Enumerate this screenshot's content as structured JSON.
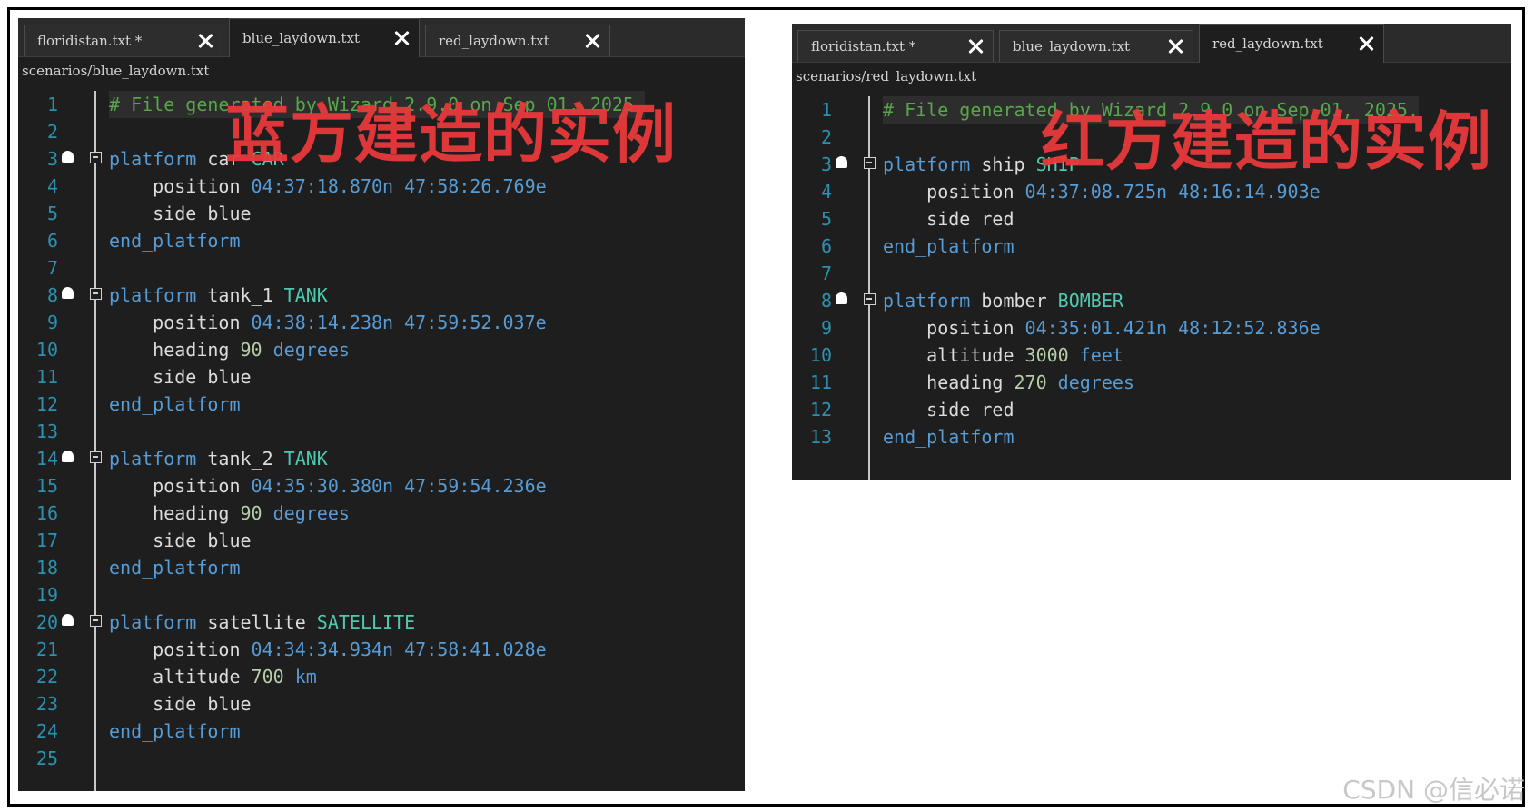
{
  "left_editor": {
    "tabs": [
      {
        "label": "floridistan.txt *",
        "active": false
      },
      {
        "label": "blue_laydown.txt",
        "active": true
      },
      {
        "label": "red_laydown.txt",
        "active": false
      }
    ],
    "path": "scenarios/blue_laydown.txt",
    "overlay_title": "蓝方建造的实例",
    "lines": [
      {
        "n": "1",
        "parts": [
          [
            "cm",
            "# File generated by Wizard 2.9.0 on Sep 01, 2025."
          ]
        ],
        "hl": true
      },
      {
        "n": "2",
        "parts": []
      },
      {
        "n": "3",
        "fold": true,
        "parts": [
          [
            "kw",
            "platform"
          ],
          [
            "tx",
            " car "
          ],
          [
            "ty",
            "CAR"
          ]
        ]
      },
      {
        "n": "4",
        "parts": [
          [
            "tx",
            "    position "
          ],
          [
            "kw",
            "04:37:18.870n 47:58:26.769e"
          ]
        ]
      },
      {
        "n": "5",
        "parts": [
          [
            "tx",
            "    side blue"
          ]
        ]
      },
      {
        "n": "6",
        "parts": [
          [
            "kw",
            "end_platform"
          ]
        ]
      },
      {
        "n": "7",
        "parts": []
      },
      {
        "n": "8",
        "fold": true,
        "parts": [
          [
            "kw",
            "platform"
          ],
          [
            "tx",
            " tank_1 "
          ],
          [
            "ty",
            "TANK"
          ]
        ]
      },
      {
        "n": "9",
        "parts": [
          [
            "tx",
            "    position "
          ],
          [
            "kw",
            "04:38:14.238n 47:59:52.037e"
          ]
        ]
      },
      {
        "n": "10",
        "parts": [
          [
            "tx",
            "    heading "
          ],
          [
            "num",
            "90"
          ],
          [
            "tx",
            " "
          ],
          [
            "kw",
            "degrees"
          ]
        ]
      },
      {
        "n": "11",
        "parts": [
          [
            "tx",
            "    side blue"
          ]
        ]
      },
      {
        "n": "12",
        "parts": [
          [
            "kw",
            "end_platform"
          ]
        ]
      },
      {
        "n": "13",
        "parts": []
      },
      {
        "n": "14",
        "fold": true,
        "parts": [
          [
            "kw",
            "platform"
          ],
          [
            "tx",
            " tank_2 "
          ],
          [
            "ty",
            "TANK"
          ]
        ]
      },
      {
        "n": "15",
        "parts": [
          [
            "tx",
            "    position "
          ],
          [
            "kw",
            "04:35:30.380n 47:59:54.236e"
          ]
        ]
      },
      {
        "n": "16",
        "parts": [
          [
            "tx",
            "    heading "
          ],
          [
            "num",
            "90"
          ],
          [
            "tx",
            " "
          ],
          [
            "kw",
            "degrees"
          ]
        ]
      },
      {
        "n": "17",
        "parts": [
          [
            "tx",
            "    side blue"
          ]
        ]
      },
      {
        "n": "18",
        "parts": [
          [
            "kw",
            "end_platform"
          ]
        ]
      },
      {
        "n": "19",
        "parts": []
      },
      {
        "n": "20",
        "fold": true,
        "parts": [
          [
            "kw",
            "platform"
          ],
          [
            "tx",
            " satellite "
          ],
          [
            "ty",
            "SATELLITE"
          ]
        ]
      },
      {
        "n": "21",
        "parts": [
          [
            "tx",
            "    position "
          ],
          [
            "kw",
            "04:34:34.934n 47:58:41.028e"
          ]
        ]
      },
      {
        "n": "22",
        "parts": [
          [
            "tx",
            "    altitude "
          ],
          [
            "num",
            "700"
          ],
          [
            "tx",
            " "
          ],
          [
            "kw",
            "km"
          ]
        ]
      },
      {
        "n": "23",
        "parts": [
          [
            "tx",
            "    side blue"
          ]
        ]
      },
      {
        "n": "24",
        "parts": [
          [
            "kw",
            "end_platform"
          ]
        ]
      },
      {
        "n": "25",
        "parts": []
      }
    ]
  },
  "right_editor": {
    "tabs": [
      {
        "label": "floridistan.txt *",
        "active": false
      },
      {
        "label": "blue_laydown.txt",
        "active": false
      },
      {
        "label": "red_laydown.txt",
        "active": true
      }
    ],
    "path": "scenarios/red_laydown.txt",
    "overlay_title": "红方建造的实例",
    "lines": [
      {
        "n": "1",
        "parts": [
          [
            "cm",
            "# File generated by Wizard 2.9.0 on Sep 01, 2025."
          ]
        ],
        "hl": true
      },
      {
        "n": "2",
        "parts": []
      },
      {
        "n": "3",
        "fold": true,
        "parts": [
          [
            "kw",
            "platform"
          ],
          [
            "tx",
            " ship "
          ],
          [
            "ty",
            "SHIP"
          ]
        ]
      },
      {
        "n": "4",
        "parts": [
          [
            "tx",
            "    position "
          ],
          [
            "kw",
            "04:37:08.725n 48:16:14.903e"
          ]
        ]
      },
      {
        "n": "5",
        "parts": [
          [
            "tx",
            "    side red"
          ]
        ]
      },
      {
        "n": "6",
        "parts": [
          [
            "kw",
            "end_platform"
          ]
        ]
      },
      {
        "n": "7",
        "parts": []
      },
      {
        "n": "8",
        "fold": true,
        "parts": [
          [
            "kw",
            "platform"
          ],
          [
            "tx",
            " bomber "
          ],
          [
            "ty",
            "BOMBER"
          ]
        ]
      },
      {
        "n": "9",
        "parts": [
          [
            "tx",
            "    position "
          ],
          [
            "kw",
            "04:35:01.421n 48:12:52.836e"
          ]
        ]
      },
      {
        "n": "10",
        "parts": [
          [
            "tx",
            "    altitude "
          ],
          [
            "num",
            "3000"
          ],
          [
            "tx",
            " "
          ],
          [
            "kw",
            "feet"
          ]
        ]
      },
      {
        "n": "11",
        "parts": [
          [
            "tx",
            "    heading "
          ],
          [
            "num",
            "270"
          ],
          [
            "tx",
            " "
          ],
          [
            "kw",
            "degrees"
          ]
        ]
      },
      {
        "n": "12",
        "parts": [
          [
            "tx",
            "    side red"
          ]
        ]
      },
      {
        "n": "13",
        "parts": [
          [
            "kw",
            "end_platform"
          ]
        ]
      }
    ]
  },
  "watermark": "CSDN @信必诺"
}
